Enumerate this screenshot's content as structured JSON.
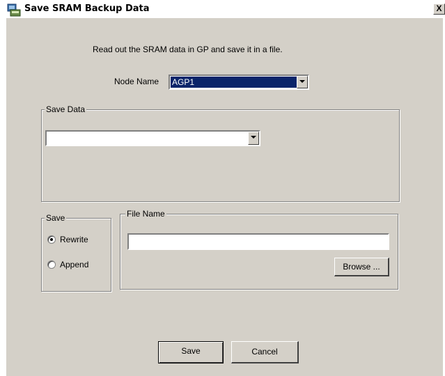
{
  "window": {
    "title": "Save SRAM Backup Data",
    "close_label": "X"
  },
  "intro": "Read out the SRAM data in GP and save it in a file.",
  "node": {
    "label": "Node Name",
    "value": "AGP1"
  },
  "save_data": {
    "label": "Save Data",
    "value": ""
  },
  "save_mode": {
    "label": "Save",
    "options": [
      "Rewrite",
      "Append"
    ],
    "selected": "Rewrite"
  },
  "file": {
    "label": "File Name",
    "value": "",
    "browse_label": "Browse ..."
  },
  "buttons": {
    "save": "Save",
    "cancel": "Cancel"
  },
  "colors": {
    "dialog_bg": "#d4d0c8",
    "selection": "#0a246a"
  }
}
